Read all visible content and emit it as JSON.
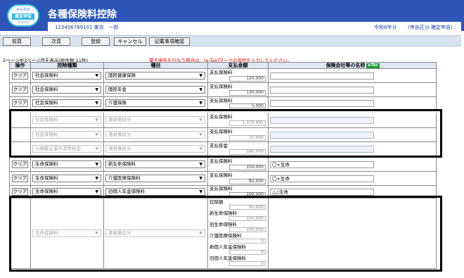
{
  "header": {
    "logo_top": "みんなの",
    "logo_mid": "確定申告",
    "logo_bottom": "クラウド",
    "title": "各種保険料控除",
    "user_line": "123456789101 東京　一郎",
    "era": "令和6年分",
    "category": "(申告区分:確定申告)"
  },
  "toolbar": {
    "prev": "前頁",
    "next": "次頁",
    "register": "登録",
    "cancel": "キャンセル",
    "check": "記載事項確認"
  },
  "page_info": "2ページ中1ページ目を表示(総件数:11件)",
  "notice": "電子申告を行なう場合は、[e-Tax]マークの項目を入力してください。",
  "columns": {
    "op": "操作",
    "type": "控除種類",
    "item": "種目",
    "amount": "支払金額",
    "company": "保険会社等の名称",
    "etax": "e-Tax"
  },
  "clear_label": "クリア",
  "rows": [
    {
      "type": "社会保険料",
      "item": "国民健康保険",
      "amount_label": "支払保険料",
      "amount": "120,000",
      "company": ""
    },
    {
      "type": "社会保険料",
      "item": "国民年金",
      "amount_label": "支払保険料",
      "amount": "130,000",
      "company": ""
    },
    {
      "type": "社会保険料",
      "item": "介護保険",
      "amount_label": "支払保険料",
      "amount": "5,000",
      "company": ""
    },
    {
      "type": "社会保険料",
      "item": "源泉徴収分",
      "amount_label": "支払保険料",
      "amount": "1,370,695",
      "company": ""
    },
    {
      "type": "社会保険料",
      "item": "源泉徴収分",
      "amount_label": "支払保険料",
      "amount": "10,000",
      "company": ""
    },
    {
      "type": "小規模企業共済等掛金",
      "item": "源泉徴収分",
      "amount_label": "支払掛金",
      "amount": "180,000",
      "company": ""
    },
    {
      "type": "生命保険料",
      "item": "新生命保険料",
      "amount_label": "支払保険料",
      "amount": "150,000",
      "company": "〇×生命"
    },
    {
      "type": "生命保険料",
      "item": "介護医療保険料",
      "amount_label": "支払保険料",
      "amount": "82,000",
      "company": "〇×生命"
    },
    {
      "type": "生命保険料",
      "item": "旧個人年金保険料",
      "amount_label": "支払保険料",
      "amount": "100,000",
      "company": "△△生命"
    }
  ],
  "big_row": {
    "type": "生命保険料",
    "item": "源泉徴収分",
    "entries": [
      {
        "label": "控除額",
        "value": "90,000"
      },
      {
        "label": "新生命保険料",
        "value": "100,000"
      },
      {
        "label": "旧生命保険料",
        "value": "100,000"
      },
      {
        "label": "介護医療保険料",
        "value": "0"
      },
      {
        "label": "新個人年金保険料",
        "value": "0"
      },
      {
        "label": "旧個人年金保険料",
        "value": "0"
      }
    ]
  },
  "colors": {
    "header_blue": "#2d56b8",
    "logo_accent": "#35b8e0",
    "notice_red": "#e00000",
    "etax_green": "#1f9d3a"
  }
}
